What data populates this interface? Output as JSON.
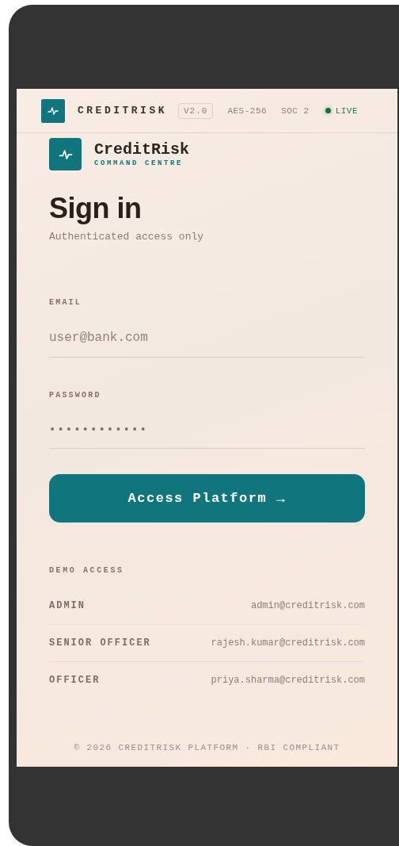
{
  "header": {
    "brand": "CREDITRISK",
    "version": "V2.0",
    "badges": [
      "AES-256",
      "SOC 2"
    ],
    "status": {
      "label": "LIVE",
      "on": true
    }
  },
  "logo": {
    "name": "CreditRisk",
    "subtitle": "COMMAND CENTRE"
  },
  "title": "Sign in",
  "subtitle": "Authenticated access only",
  "fields": [
    {
      "label": "EMAIL",
      "placeholder": "user@bank.com"
    },
    {
      "label": "PASSWORD",
      "value": "••••••••••••"
    }
  ],
  "submit": {
    "label": "Access Platform",
    "arrow": "→"
  },
  "demo": {
    "heading": "DEMO ACCESS",
    "rows": [
      {
        "role": "ADMIN",
        "email": "admin@creditrisk.com"
      },
      {
        "role": "SENIOR OFFICER",
        "email": "rajesh.kumar@creditrisk.com"
      },
      {
        "role": "OFFICER",
        "email": "priya.sharma@creditrisk.com"
      }
    ]
  },
  "footer": "© 2026 CREDITRISK PLATFORM · RBI COMPLIANT"
}
